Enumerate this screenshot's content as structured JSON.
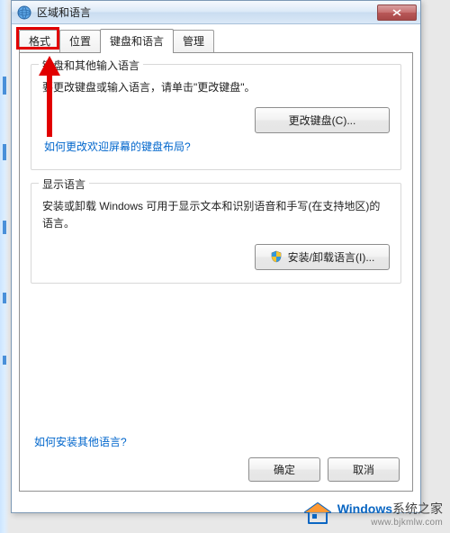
{
  "window": {
    "title": "区域和语言"
  },
  "tabs": {
    "format": "格式",
    "location": "位置",
    "keyboards": "键盘和语言",
    "admin": "管理"
  },
  "group_keyboard": {
    "title": "键盘和其他输入语言",
    "desc": "要更改键盘或输入语言，请单击\"更改键盘\"。",
    "button": "更改键盘(C)...",
    "link": "如何更改欢迎屏幕的键盘布局?"
  },
  "group_display": {
    "title": "显示语言",
    "desc": "安装或卸载 Windows 可用于显示文本和识别语音和手写(在支持地区)的语言。",
    "button": "安装/卸载语言(I)..."
  },
  "bottom_link": "如何安装其他语言?",
  "dialog": {
    "ok": "确定",
    "cancel": "取消"
  },
  "watermark": {
    "brand_head": "Windows",
    "brand_tail": "系统之家",
    "url": "www.bjkmlw.com"
  }
}
